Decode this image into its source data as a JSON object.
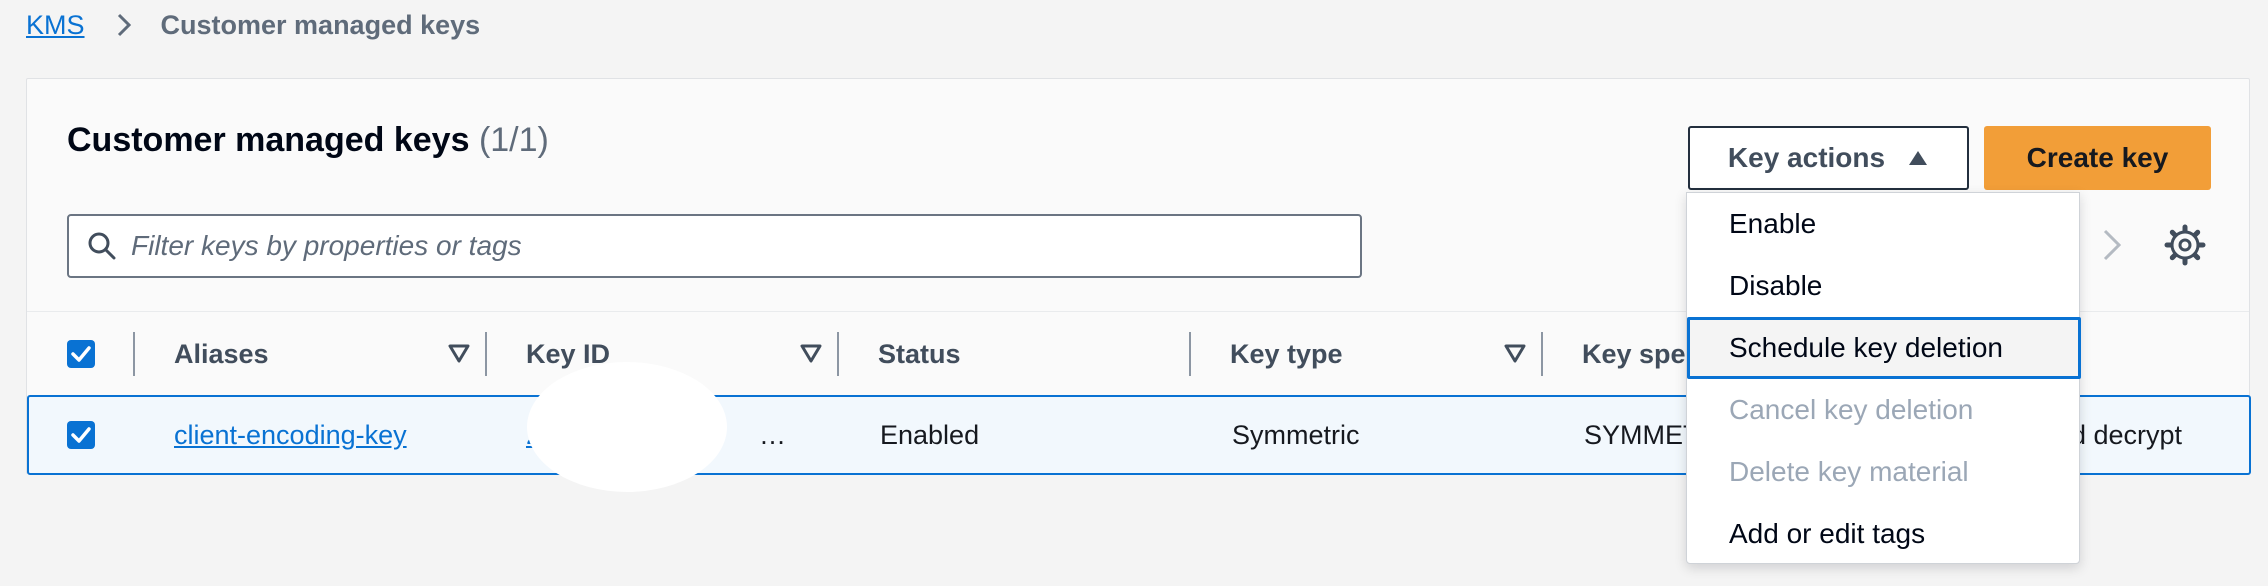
{
  "breadcrumb": {
    "root": "KMS",
    "current": "Customer managed keys"
  },
  "panel": {
    "title": "Customer managed keys",
    "count": "(1/1)"
  },
  "buttons": {
    "key_actions": "Key actions",
    "create_key": "Create key"
  },
  "search": {
    "placeholder": "Filter keys by properties or tags",
    "value": ""
  },
  "table": {
    "columns": [
      "Aliases",
      "Key ID",
      "Status",
      "Key type",
      "Key spec"
    ],
    "rows": [
      {
        "selected": true,
        "alias": "client-encoding-key",
        "key_id": "20",
        "key_id_tail": "…",
        "status": "Enabled",
        "key_type": "Symmetric",
        "key_spec": "SYMMET",
        "key_usage_tail": "d decrypt"
      }
    ]
  },
  "key_actions_menu": {
    "items": [
      {
        "label": "Enable",
        "state": "enabled"
      },
      {
        "label": "Disable",
        "state": "enabled"
      },
      {
        "label": "Schedule key deletion",
        "state": "focused"
      },
      {
        "label": "Cancel key deletion",
        "state": "disabled"
      },
      {
        "label": "Delete key material",
        "state": "disabled"
      },
      {
        "label": "Add or edit tags",
        "state": "enabled"
      }
    ]
  },
  "icons": {
    "search": "search-icon",
    "settings": "gear-icon",
    "next_page": "chevron-right-icon",
    "breadcrumb_separator": "chevron-right-icon",
    "sort": "caret-down-icon",
    "dropdown": "caret-up-icon",
    "checkbox": "check-icon"
  },
  "colors": {
    "link": "#0972d3",
    "primary_button": "#f29e38",
    "selected_row": "#f2f8fd",
    "disabled_text": "#9ba7b6"
  }
}
